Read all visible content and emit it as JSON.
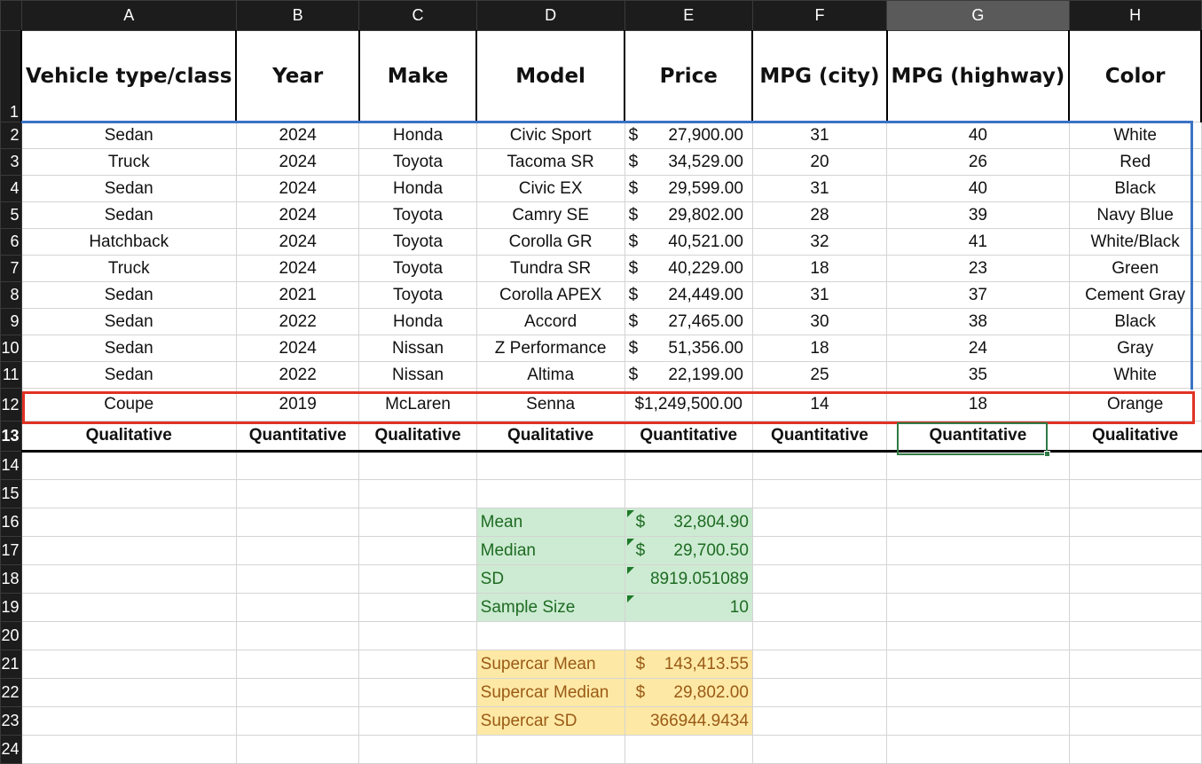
{
  "columns": [
    "A",
    "B",
    "C",
    "D",
    "E",
    "F",
    "G",
    "H"
  ],
  "headers": [
    "Vehicle type/class",
    "Year",
    "Make",
    "Model",
    "Price",
    "MPG (city)",
    "MPG (highway)",
    "Color"
  ],
  "rows": [
    [
      "Sedan",
      "2024",
      "Honda",
      "Civic Sport",
      "27,900.00",
      "31",
      "40",
      "White"
    ],
    [
      "Truck",
      "2024",
      "Toyota",
      "Tacoma SR",
      "34,529.00",
      "20",
      "26",
      "Red"
    ],
    [
      "Sedan",
      "2024",
      "Honda",
      "Civic EX",
      "29,599.00",
      "31",
      "40",
      "Black"
    ],
    [
      "Sedan",
      "2024",
      "Toyota",
      "Camry SE",
      "29,802.00",
      "28",
      "39",
      "Navy Blue"
    ],
    [
      "Hatchback",
      "2024",
      "Toyota",
      "Corolla GR",
      "40,521.00",
      "32",
      "41",
      "White/Black"
    ],
    [
      "Truck",
      "2024",
      "Toyota",
      "Tundra  SR",
      "40,229.00",
      "18",
      "23",
      "Green"
    ],
    [
      "Sedan",
      "2021",
      "Toyota",
      "Corolla APEX",
      "24,449.00",
      "31",
      "37",
      "Cement Gray"
    ],
    [
      "Sedan",
      "2022",
      "Honda",
      "Accord",
      "27,465.00",
      "30",
      "38",
      "Black"
    ],
    [
      "Sedan",
      "2024",
      "Nissan",
      "Z Performance",
      "51,356.00",
      "18",
      "24",
      "Gray"
    ],
    [
      "Sedan",
      "2022",
      "Nissan",
      "Altima",
      "22,199.00",
      "25",
      "35",
      "White"
    ]
  ],
  "highlight_row": [
    "Coupe",
    "2019",
    "McLaren",
    "Senna",
    "$1,249,500.00",
    "14",
    "18",
    "Orange"
  ],
  "types": [
    "Qualitative",
    "Quantitative",
    "Qualitative",
    "Qualitative",
    "Quantitative",
    "Quantitative",
    "Quantitative",
    "Qualitative"
  ],
  "currency": "$",
  "stats": [
    {
      "label": "Mean",
      "cur": "$",
      "value": "32,804.90"
    },
    {
      "label": "Median",
      "cur": "$",
      "value": "29,700.50"
    },
    {
      "label": "SD",
      "cur": "",
      "value": "8919.051089"
    },
    {
      "label": "Sample Size",
      "cur": "",
      "value": "10"
    }
  ],
  "supercar": [
    {
      "label": "Supercar Mean",
      "cur": "$",
      "value": "143,413.55"
    },
    {
      "label": "Supercar Median",
      "cur": "$",
      "value": "29,802.00"
    },
    {
      "label": "Supercar SD",
      "cur": "",
      "value": "366944.9434"
    }
  ],
  "colors": {
    "blue_border": "#3a73c4",
    "red_border": "#e03224",
    "selection": "#2f7a45"
  }
}
